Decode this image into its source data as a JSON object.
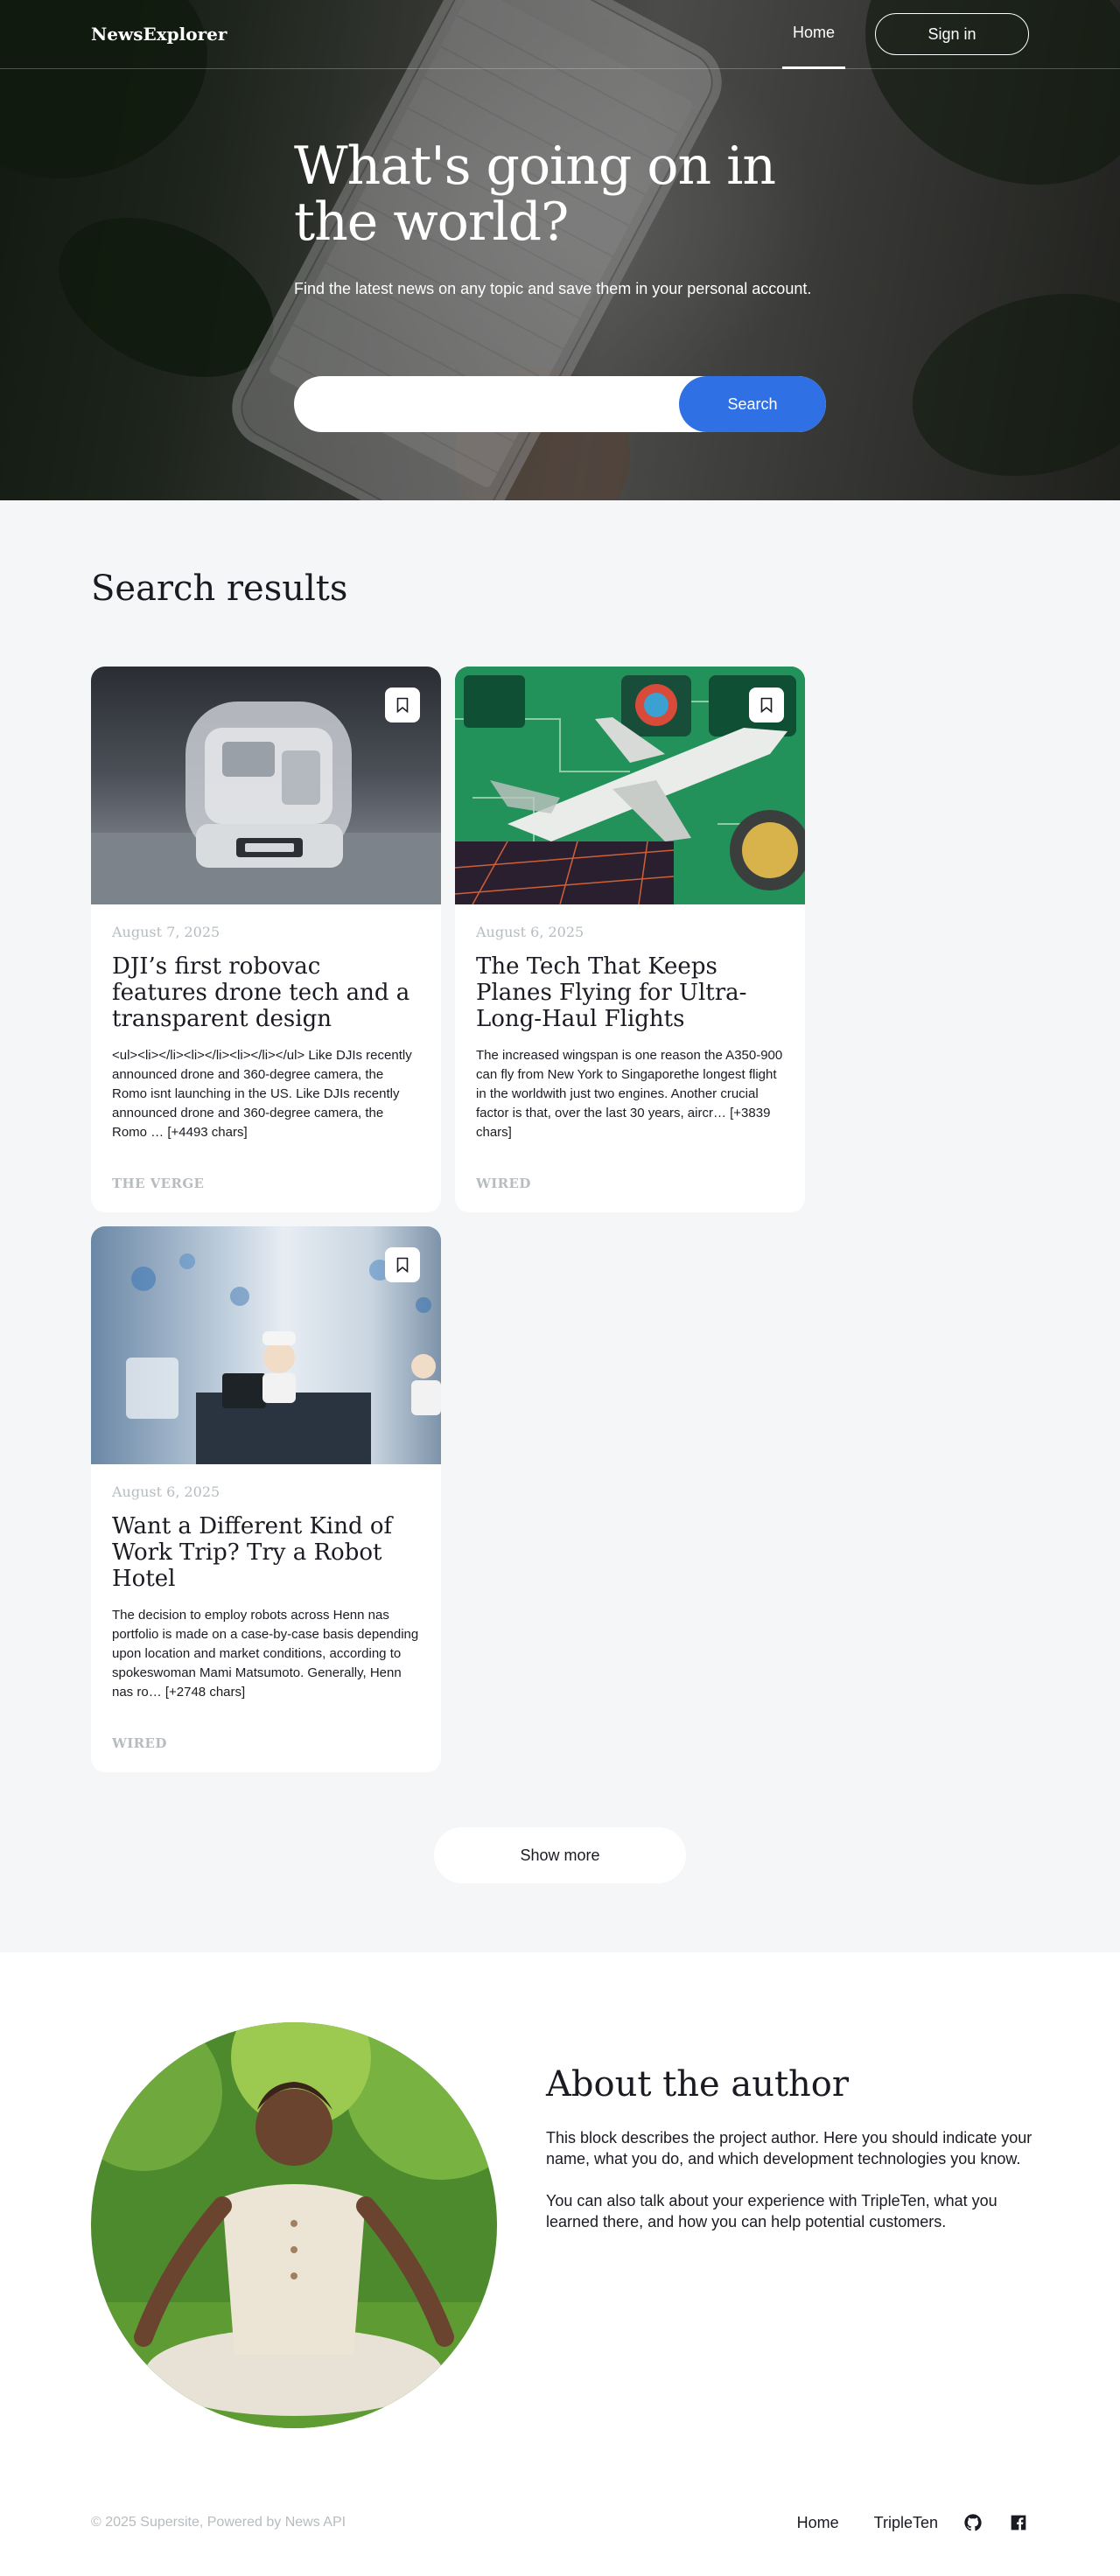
{
  "header": {
    "logo": "NewsExplorer",
    "nav_home": "Home",
    "nav_signin": "Sign in"
  },
  "hero": {
    "title": "What's going on in the world?",
    "subtitle": "Find the latest news on any topic and save them in your personal account.",
    "search_placeholder": "",
    "search_value": "",
    "search_button": "Search"
  },
  "results": {
    "title": "Search results",
    "cards": [
      {
        "date": "August 7, 2025",
        "title": "DJI’s first robovac features drone tech and a transparent design",
        "text": "<ul><li></li><li></li><li></li></ul> Like DJIs recently announced drone and 360-degree camera, the Romo isnt launching in the US. Like DJIs recently announced drone and 360-degree camera, the Romo … [+4493 chars]",
        "source": "THE VERGE",
        "image": "robot-vacuum"
      },
      {
        "date": "August 6, 2025",
        "title": "The Tech That Keeps Planes Flying for Ultra-Long-Haul Flights",
        "text": "The increased wingspan is one reason the A350-900 can fly from New York to Singaporethe longest flight in the worldwith just two engines. Another crucial factor is that, over the last 30 years, aircr… [+3839 chars]",
        "source": "WIRED",
        "image": "airplane-circuit-illustration"
      },
      {
        "date": "August 6, 2025",
        "title": "Want a Different Kind of Work Trip? Try a Robot Hotel",
        "text": "The decision to employ robots across Henn nas portfolio is made on a case-by-case basis depending upon location and market conditions, according to spokeswoman Mami Matsumoto. Generally, Henn nas ro… [+2748 chars]",
        "source": "WIRED",
        "image": "robot-hotel-lobby"
      }
    ],
    "show_more": "Show more"
  },
  "about": {
    "title": "About the author",
    "paragraph_1": "This block describes the project author. Here you should indicate your name, what you do, and which development technologies you know.",
    "paragraph_2": "You can also talk about your experience with TripleTen, what you learned there, and how you can help potential customers."
  },
  "footer": {
    "copyright": "© 2025 Supersite, Powered by News API",
    "link_home": "Home",
    "link_tripleten": "TripleTen",
    "icons": [
      "github-icon",
      "facebook-icon"
    ]
  },
  "colors": {
    "accent": "#2f71e5",
    "text": "#1a1b22",
    "muted": "#b6bcbf",
    "background": "#f5f6f7"
  }
}
